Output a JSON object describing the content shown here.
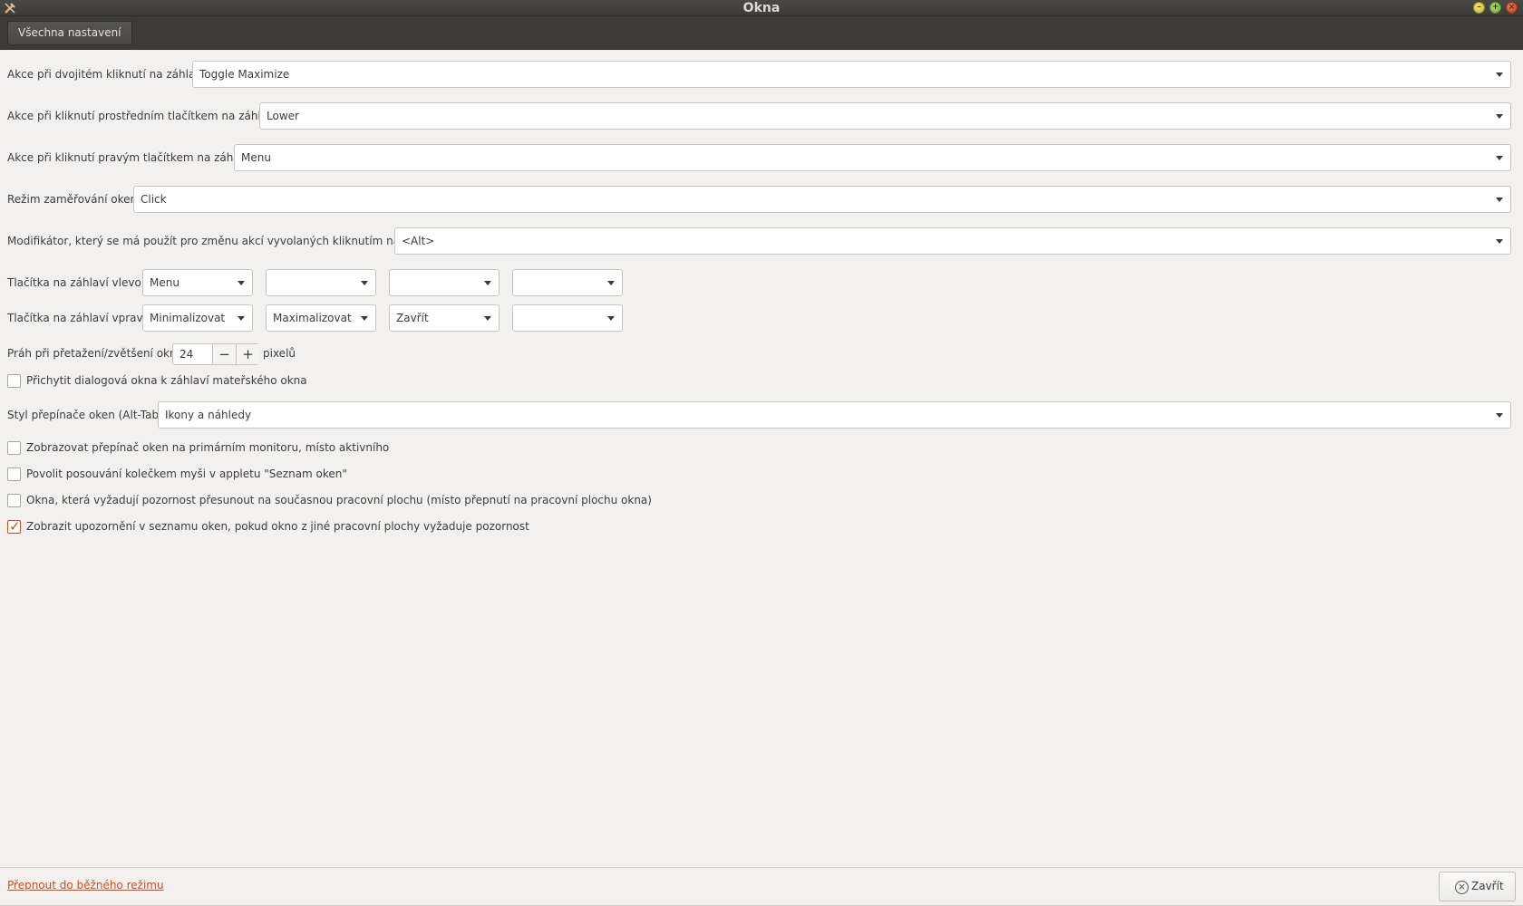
{
  "window": {
    "title": "Okna"
  },
  "toolbar": {
    "all_settings_label": "Všechna nastavení"
  },
  "settings": {
    "double_click": {
      "label": "Akce při dvojitém kliknutí na záhlaví",
      "value": "Toggle Maximize"
    },
    "middle_click": {
      "label": "Akce při kliknutí prostředním tlačítkem na záhlaví",
      "value": "Lower"
    },
    "right_click": {
      "label": "Akce při kliknutí pravým tlačítkem na záhlaví",
      "value": "Menu"
    },
    "focus_mode": {
      "label": "Režim zaměřování oken",
      "value": "Click"
    },
    "modifier": {
      "label": "Modifikátor, který se má použít pro změnu akcí vyvolaných kliknutím na okno",
      "value": "<Alt>"
    },
    "buttons_left": {
      "label": "Tlačítka na záhlaví vlevo",
      "values": [
        "Menu",
        "",
        "",
        ""
      ]
    },
    "buttons_right": {
      "label": "Tlačítka na záhlaví vpravo",
      "values": [
        "Minimalizovat",
        "Maximalizovat",
        "Zavřít",
        ""
      ]
    },
    "drag_threshold": {
      "label": "Práh při přetažení/zvětšení okna",
      "value": "24",
      "unit": "pixelů",
      "minus": "−",
      "plus": "+"
    },
    "attach_dialogs": {
      "label": "Přichytit dialogová okna k záhlaví mateřského okna",
      "checked": false
    },
    "alttab_style": {
      "label": "Styl přepínače oken (Alt-Tab)",
      "value": "Ikony a náhledy"
    },
    "checks": [
      {
        "label": "Zobrazovat přepínač oken na primárním monitoru, místo aktivního",
        "checked": false
      },
      {
        "label": "Povolit posouvání kolečkem myši v appletu \"Seznam oken\"",
        "checked": false
      },
      {
        "label": "Okna, která vyžadují pozornost přesunout na současnou pracovní plochu (místo přepnutí na pracovní plochu okna)",
        "checked": false
      },
      {
        "label": "Zobrazit upozornění v seznamu oken, pokud okno z jiné pracovní plochy vyžaduje pozornost",
        "checked": true
      }
    ]
  },
  "footer": {
    "mode_link": "Přepnout do běžného režimu",
    "close_label": "Zavřít"
  },
  "colors": {
    "accent": "#d44a18",
    "titlebar": "#3c3b37",
    "background": "#f2f1f0"
  },
  "icons": [
    "settings-tools-icon",
    "minimize-icon",
    "maximize-icon",
    "close-icon",
    "dropdown-arrow-icon",
    "close-circle-icon"
  ]
}
